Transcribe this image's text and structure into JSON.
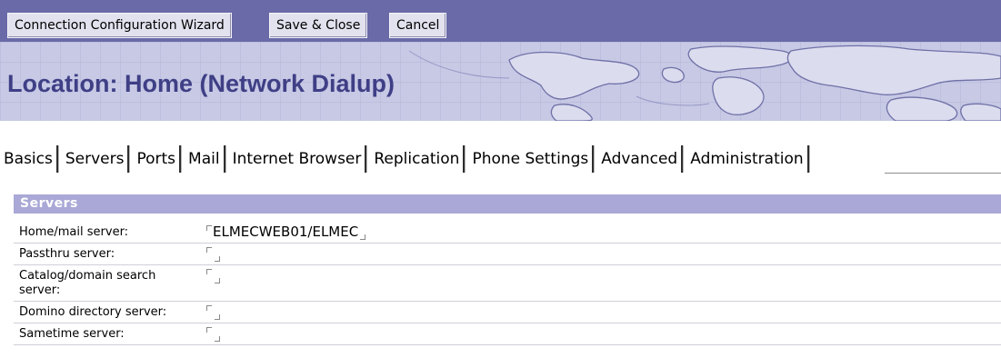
{
  "toolbar": {
    "wizard_label": "Connection Configuration Wizard",
    "save_label": "Save & Close",
    "cancel_label": "Cancel"
  },
  "banner": {
    "title": "Location: Home (Network Dialup)"
  },
  "tabs": [
    {
      "label": "Basics"
    },
    {
      "label": "Servers"
    },
    {
      "label": "Ports"
    },
    {
      "label": "Mail"
    },
    {
      "label": "Internet Browser"
    },
    {
      "label": "Replication"
    },
    {
      "label": "Phone Settings"
    },
    {
      "label": "Advanced"
    },
    {
      "label": "Administration"
    }
  ],
  "active_tab": "Servers",
  "section": {
    "title": "Servers"
  },
  "fields": [
    {
      "label": "Home/mail server:",
      "value": "ELMECWEB01/ELMEC"
    },
    {
      "label": "Passthru server:",
      "value": ""
    },
    {
      "label": "Catalog/domain search server:",
      "value": ""
    },
    {
      "label": "Domino directory server:",
      "value": ""
    },
    {
      "label": "Sametime server:",
      "value": ""
    }
  ],
  "colors": {
    "toolbar_bg": "#6a6aa8",
    "banner_bg": "#c5c7e4",
    "title_color": "#3f3f86",
    "section_header_bg": "#a9a8d6"
  }
}
